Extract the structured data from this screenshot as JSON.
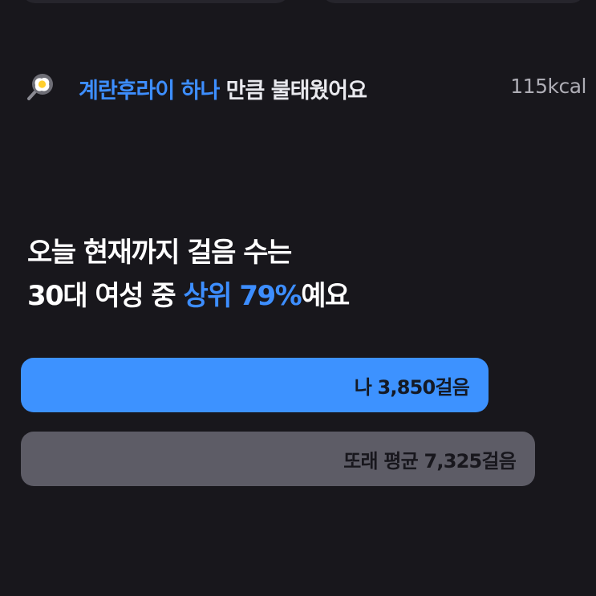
{
  "calorie": {
    "icon": "fried-egg-icon",
    "highlight": "계란후라이 하나",
    "rest": " 만큼 불태웠어요",
    "value": "115kcal"
  },
  "rank": {
    "line1": "오늘 현재까지 걸음 수는",
    "line2_prefix": "30대 여성 중 ",
    "line2_highlight": "상위 79%",
    "line2_suffix": "예요"
  },
  "comparison": {
    "me": {
      "label": "나 3,850걸음",
      "steps": 3850
    },
    "peer_average": {
      "label": "또래 평균 7,325걸음",
      "steps": 7325
    }
  },
  "colors": {
    "background": "#18171c",
    "accent": "#3d8eff",
    "me_bar": "#3d92ff",
    "average_bar": "#5d5c66"
  }
}
